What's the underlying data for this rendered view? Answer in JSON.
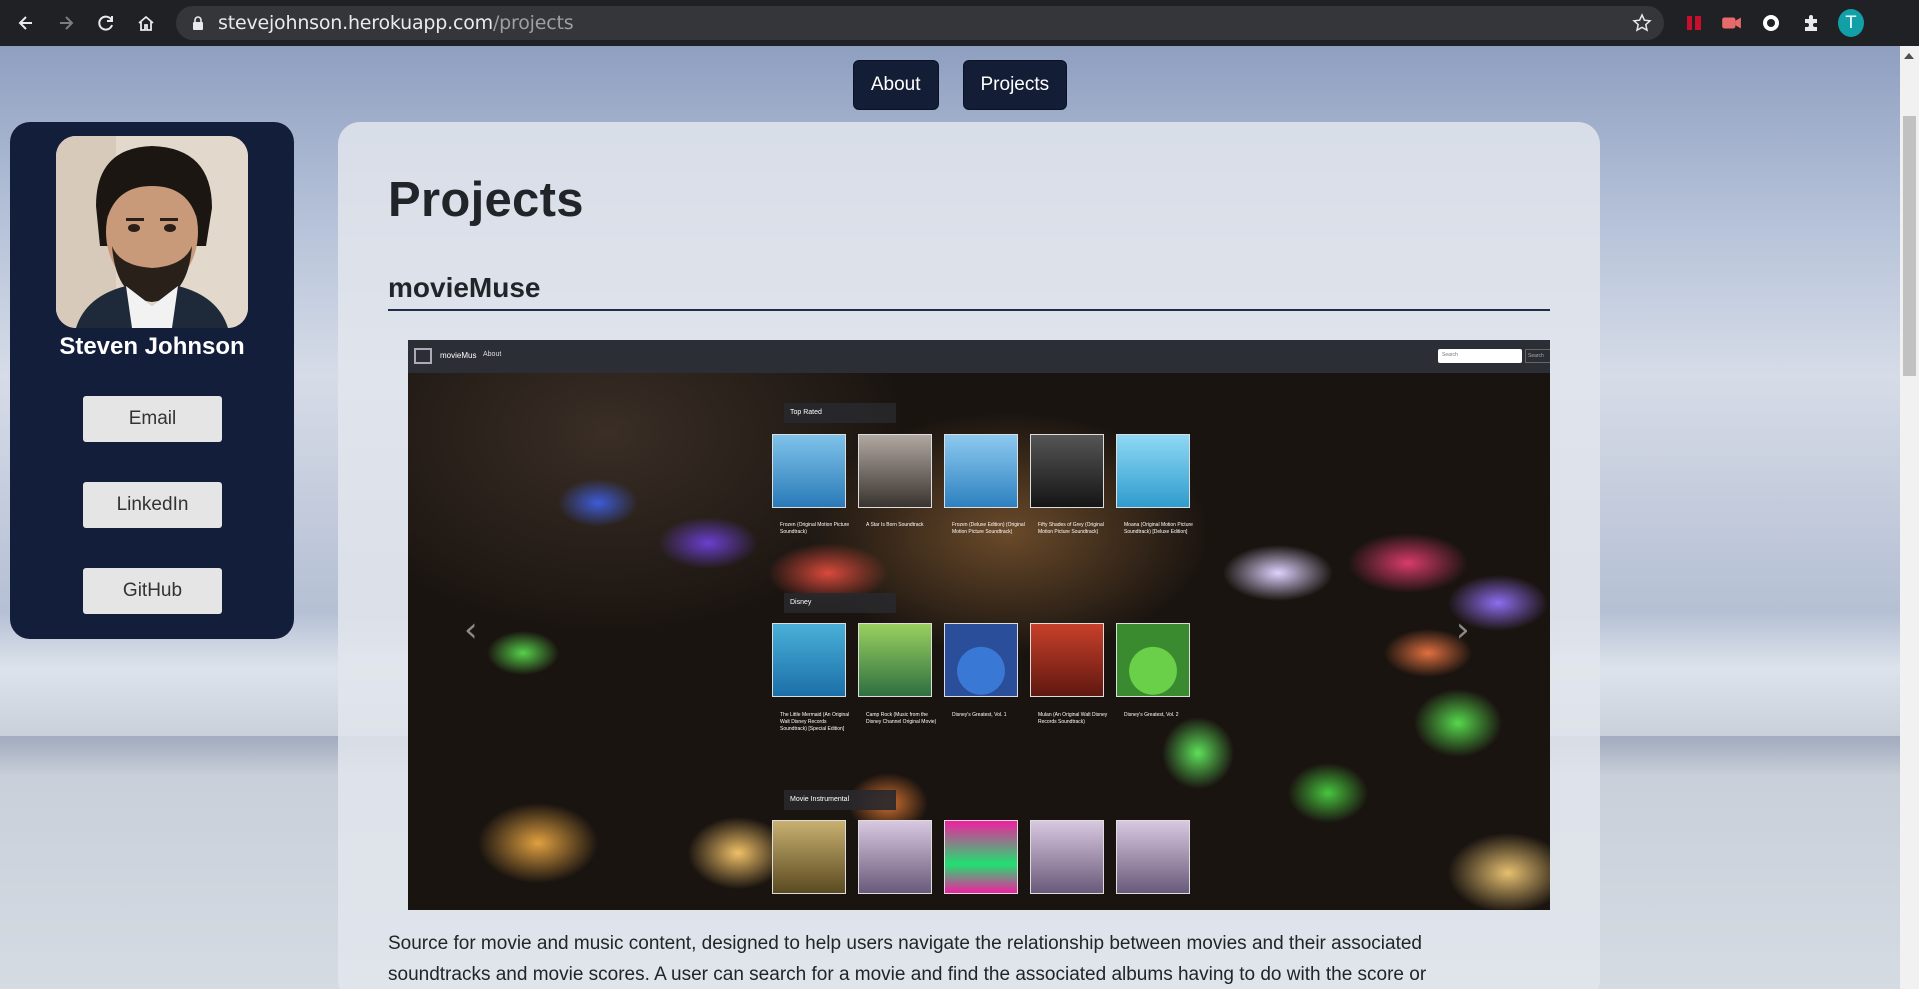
{
  "browser": {
    "url_host": "stevejohnson.herokuapp.com",
    "url_path": "/projects",
    "profile_initial": "T"
  },
  "nav": {
    "about": "About",
    "projects": "Projects"
  },
  "sidebar": {
    "name": "Steven Johnson",
    "buttons": {
      "email": "Email",
      "linkedin": "LinkedIn",
      "github": "GitHub"
    }
  },
  "main": {
    "title": "Projects",
    "project_title": "movieMuse",
    "description": "Source for movie and music content, designed to help users navigate the relationship between movies and their associated soundtracks and movie scores. A user can search for a movie and find the associated albums having to do with the score or"
  },
  "screenshot": {
    "brand": "movieMus",
    "about": "About",
    "search_placeholder": "Search",
    "search_button": "Search",
    "categories": [
      "Top Rated",
      "Disney",
      "Movie Instrumental"
    ],
    "top_rated": [
      "Frozen (Original Motion Picture Soundtrack)",
      "A Star Is Born Soundtrack",
      "Frozen (Deluxe Edition) (Original Motion Picture Soundtrack)",
      "Fifty Shades of Grey (Original Motion Picture Soundtrack)",
      "Moana (Original Motion Picture Soundtrack) [Deluxe Edition]"
    ],
    "disney": [
      "The Little Mermaid (An Original Walt Disney Records Soundtrack) [Special Edition]",
      "Camp Rock (Music from the Disney Channel Original Movie)",
      "Disney's Greatest, Vol. 1",
      "Mulan (An Original Walt Disney Records Soundtrack)",
      "Disney's Greatest, Vol. 2"
    ]
  },
  "colors": {
    "navy": "#131e36",
    "card": "#e2e5ec"
  }
}
